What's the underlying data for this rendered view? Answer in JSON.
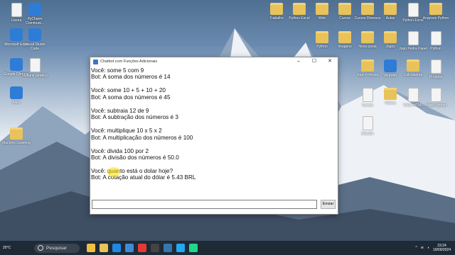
{
  "desktop": {
    "left_icons": [
      {
        "label": "Lixeira",
        "kind": "file"
      },
      {
        "label": "PyCharm Communi...",
        "kind": "app"
      },
      {
        "label": "Microsoft Edge",
        "kind": "app"
      },
      {
        "label": "Visual Studio Code",
        "kind": "app"
      },
      {
        "label": "Google Chrome",
        "kind": "app"
      },
      {
        "label": "Nubank (atalho)",
        "kind": "file"
      },
      {
        "label": "Alura",
        "kind": "app"
      },
      {
        "label": "Machine Learning",
        "kind": "folder"
      }
    ],
    "right_icons": [
      {
        "label": "Trabalho",
        "kind": "folder"
      },
      {
        "label": "Python Excel",
        "kind": "folder"
      },
      {
        "label": "Web",
        "kind": "folder"
      },
      {
        "label": "Cursos",
        "kind": "folder"
      },
      {
        "label": "Cursos Diversos",
        "kind": "folder"
      },
      {
        "label": "Aulas",
        "kind": "folder"
      },
      {
        "label": "Python Excel",
        "kind": "file"
      },
      {
        "label": "Arquivos Python",
        "kind": "folder"
      },
      {
        "label": "Python",
        "kind": "folder"
      },
      {
        "label": "Imagens",
        "kind": "folder"
      },
      {
        "label": "Nova pasta",
        "kind": "folder"
      },
      {
        "label": "Jogos",
        "kind": "folder"
      },
      {
        "label": "Jogo Pedra Papel",
        "kind": "file"
      },
      {
        "label": "Python",
        "kind": "file"
      },
      {
        "label": "Jogo Fórmula",
        "kind": "folder"
      },
      {
        "label": "WinRAR",
        "kind": "app"
      },
      {
        "label": "Calculadora",
        "kind": "folder"
      },
      {
        "label": "Projetos",
        "kind": "file"
      },
      {
        "label": "Cursos",
        "kind": "file"
      },
      {
        "label": "Vídeos",
        "kind": "folder"
      },
      {
        "label": "Vídeo HTML",
        "kind": "file"
      },
      {
        "label": "Vídeo Python",
        "kind": "file"
      },
      {
        "label": "Desafio",
        "kind": "file"
      }
    ]
  },
  "window": {
    "title": "Chatbot com Funções Adicionais",
    "minimize": "–",
    "maximize": "☐",
    "close": "✕",
    "chat_lines": [
      "Você: some 5 com 9",
      "Bot: A soma dos números é 14",
      "",
      "Você: some 10 + 5 + 10 + 20",
      "Bot: A soma dos números é 45",
      "",
      "Você: subtraia 12 de 9",
      "Bot: A subtração dos números é 3",
      "",
      "Você: multiplique 10 x 5 x 2",
      "Bot: A multiplicação dos números é 100",
      "",
      "Você: divida 100 por 2",
      "Bot: A divisão dos números é 50.0",
      "",
      "Você: quanto está o dolar hoje?",
      "Bot: A cotação atual do dólar é 5.43 BRL"
    ],
    "input_value": "",
    "send_label": "Enviar"
  },
  "taskbar": {
    "weather": "25°C",
    "search_placeholder": "Pesquisar",
    "time": "23:24",
    "date": "19/09/2024"
  },
  "colors": {
    "taskbar_bg": "#1f2a37",
    "window_bg": "#ffffff",
    "folder": "#e8c25a"
  }
}
